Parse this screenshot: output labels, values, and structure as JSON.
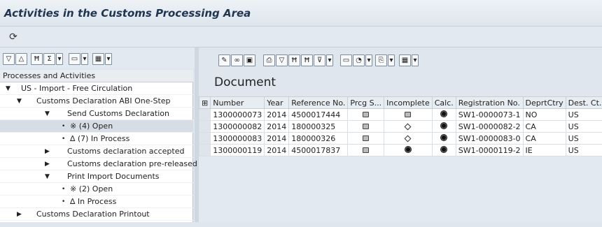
{
  "title": "Activities in the Customs Processing Area",
  "document_title": "Document",
  "tree": {
    "header": "Processes and Activities",
    "rows": [
      {
        "label": "US - Import - Free Circulation",
        "prefix": "▼",
        "level": 0
      },
      {
        "label": "Customs Declaration ABI One-Step",
        "prefix": "▼",
        "level": 1
      },
      {
        "label": "Send Customs Declaration",
        "prefix": "▼",
        "level": 2
      },
      {
        "label": "※ (4) Open",
        "prefix": "•",
        "level": 3,
        "selected": true
      },
      {
        "label": "∆ (7) In Process",
        "prefix": "•",
        "level": 3
      },
      {
        "label": "Customs declaration accepted",
        "prefix": "▶",
        "level": 2
      },
      {
        "label": "Customs declaration pre-released",
        "prefix": "▶",
        "level": 2
      },
      {
        "label": "Print Import Documents",
        "prefix": "▼",
        "level": 2
      },
      {
        "label": "※ (2) Open",
        "prefix": "•",
        "level": 3
      },
      {
        "label": "∆ In Process",
        "prefix": "•",
        "level": 3
      },
      {
        "label": "Customs Declaration Printout",
        "prefix": "▶",
        "level": 1
      }
    ]
  },
  "table": {
    "headers": [
      "Number",
      "Year",
      "Reference No.",
      "Prcg S...",
      "Incomplete",
      "Calc.",
      "Registration No.",
      "DeprtCtry",
      "Dest. Ct..."
    ],
    "rows": [
      {
        "number": "1300000073",
        "year": "2014",
        "ref": "4500017444",
        "prcg": "square",
        "incomplete": "square",
        "calc": "light",
        "reg": "SW1-0000073-1",
        "dep": "NO",
        "dest": "US"
      },
      {
        "number": "1300000082",
        "year": "2014",
        "ref": "180000325",
        "prcg": "square",
        "incomplete": "diamond",
        "calc": "light",
        "reg": "SW1-0000082-2",
        "dep": "CA",
        "dest": "US"
      },
      {
        "number": "1300000083",
        "year": "2014",
        "ref": "180000326",
        "prcg": "square",
        "incomplete": "diamond",
        "calc": "light",
        "reg": "SW1-0000083-0",
        "dep": "CA",
        "dest": "US"
      },
      {
        "number": "1300000119",
        "year": "2014",
        "ref": "4500017837",
        "prcg": "square",
        "incomplete": "light",
        "calc": "light",
        "reg": "SW1-0000119-2",
        "dep": "IE",
        "dest": "US"
      }
    ]
  },
  "icons": {
    "refresh": "refresh-icon",
    "left_toolbar": [
      "expand-icon",
      "collapse-icon",
      "find-icon",
      "sum-icon",
      "dropdown-icon",
      "layout-icon",
      "dropdown-icon",
      "export-icon",
      "dropdown-icon"
    ],
    "right_toolbar": [
      "edit-icon",
      "link-icon",
      "display-icon",
      "print-icon",
      "filter-icon",
      "find-icon",
      "find-next-icon",
      "set-filter-icon",
      "layout-icon",
      "graphic-icon",
      "export-icon",
      "columns-icon"
    ]
  }
}
